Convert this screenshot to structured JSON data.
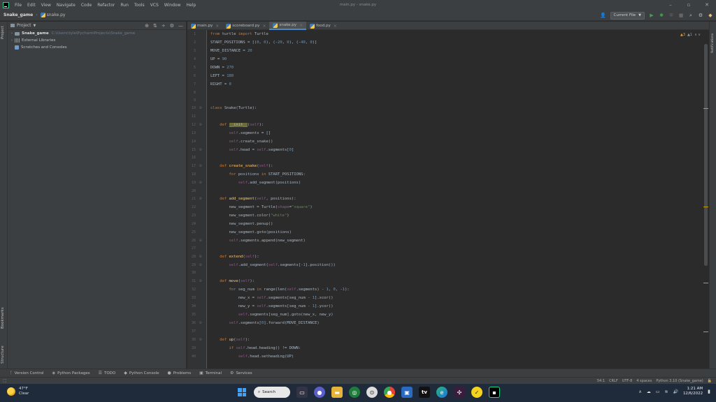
{
  "menu": {
    "items": [
      "File",
      "Edit",
      "View",
      "Navigate",
      "Code",
      "Refactor",
      "Run",
      "Tools",
      "VCS",
      "Window",
      "Help"
    ],
    "window_title": "main.py - snake.py"
  },
  "window_controls": {
    "minimize": "–",
    "restore": "▫",
    "close": "✕"
  },
  "navbar": {
    "project": "Snake_game",
    "file": "snake.py",
    "run_config": "Current File"
  },
  "left_stripe": {
    "project": "Project",
    "bookmarks": "Bookmarks",
    "structure": "Structure"
  },
  "project_panel": {
    "header": "Project",
    "tree": [
      {
        "label": "Snake_game",
        "hint": "C:\\Users\\tyle\\PycharmProjects\\Snake_game",
        "type": "folder"
      },
      {
        "label": "External Libraries",
        "hint": "",
        "type": "lib"
      },
      {
        "label": "Scratches and Consoles",
        "hint": "",
        "type": "scratch"
      }
    ]
  },
  "tabs": [
    {
      "label": "main.py",
      "active": false
    },
    {
      "label": "scoreboard.py",
      "active": false
    },
    {
      "label": "snake.py",
      "active": true
    },
    {
      "label": "food.py",
      "active": false
    }
  ],
  "inspection": {
    "warnings": "▲3",
    "weak": "▲1",
    "nav": "∧ ∨"
  },
  "code": {
    "line_numbers": [
      "1",
      "2",
      "3",
      "4",
      "5",
      "6",
      "7",
      "8",
      "9",
      "10",
      "11",
      "12",
      "13",
      "14",
      "15",
      "16",
      "17",
      "18",
      "19",
      "20",
      "21",
      "22",
      "23",
      "24",
      "25",
      "26",
      "27",
      "28",
      "29",
      "30",
      "31",
      "32",
      "33",
      "34",
      "35",
      "36",
      "37",
      "38",
      "39",
      "40"
    ]
  },
  "bottom_tools": [
    "Version Control",
    "Python Packages",
    "TODO",
    "Python Console",
    "Problems",
    "Terminal",
    "Services"
  ],
  "status": {
    "position": "54:1",
    "line_sep": "CRLF",
    "encoding": "UTF-8",
    "indent": "4 spaces",
    "interpreter": "Python 3.10 (Snake_game)"
  },
  "right_stripe": {
    "notifications": "Notifications"
  },
  "taskbar": {
    "weather_temp": "47°F",
    "weather_desc": "Clear",
    "search": "Search",
    "time": "1:21 AM",
    "date": "12/6/2022"
  }
}
